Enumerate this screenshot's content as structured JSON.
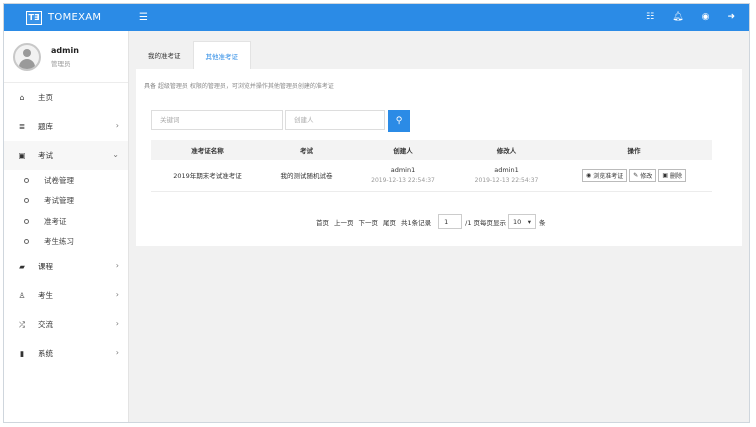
{
  "brand": {
    "logo": "T∃",
    "name": "TOMEXAM"
  },
  "topbar": {
    "menu_icon": "☰",
    "icons": [
      "list-icon",
      "bell-icon",
      "user-icon",
      "logout-icon"
    ]
  },
  "user": {
    "name": "admin",
    "role": "管理员"
  },
  "nav": [
    {
      "label": "主页",
      "icon": "home-icon"
    },
    {
      "label": "题库",
      "icon": "database-icon"
    },
    {
      "label": "考试",
      "icon": "calendar-icon",
      "open": true,
      "sub": [
        "试卷管理",
        "考试管理",
        "准考证",
        "考生练习"
      ]
    },
    {
      "label": "课程",
      "icon": "book-icon"
    },
    {
      "label": "考生",
      "icon": "person-icon"
    },
    {
      "label": "交流",
      "icon": "shuffle-icon"
    },
    {
      "label": "系统",
      "icon": "system-icon"
    }
  ],
  "tabs": [
    "我的准考证",
    "其他准考证"
  ],
  "active_tab": 1,
  "notice": "具备 超级管理员 权限的管理员，可浏览并操作其他管理员创建的准考证",
  "search": {
    "keyword_placeholder": "关键词",
    "creator_placeholder": "创建人"
  },
  "table": {
    "headers": [
      "准考证名称",
      "考试",
      "创建人",
      "修改人",
      "操作"
    ],
    "rows": [
      {
        "name": "2019年期末考试准考证",
        "exam": "我的测试随机试卷",
        "creator": "admin1",
        "created_at": "2019-12-13 22:54:37",
        "modifier": "admin1",
        "modified_at": "2019-12-13 22:54:37",
        "actions": [
          "浏览准考证",
          "修改",
          "删除"
        ]
      }
    ]
  },
  "pager": {
    "first": "首页",
    "prev": "上一页",
    "next": "下一页",
    "last": "尾页",
    "total": "共1条记录",
    "page": "1",
    "pages": "/1 页",
    "per_label": "每页显示",
    "per_value": "10",
    "unit": "条"
  },
  "colors": {
    "accent": "#2b8be6"
  }
}
